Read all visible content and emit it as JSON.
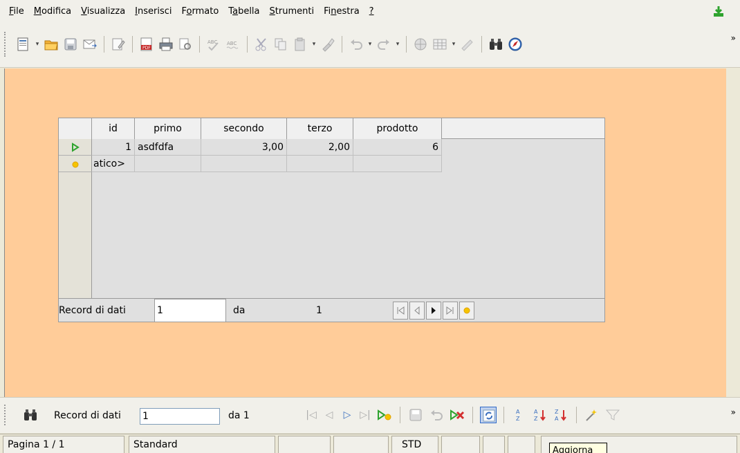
{
  "menu": [
    {
      "label": "File",
      "mnemonic_index": 0
    },
    {
      "label": "Modifica",
      "mnemonic_index": 0
    },
    {
      "label": "Visualizza",
      "mnemonic_index": 0
    },
    {
      "label": "Inserisci",
      "mnemonic_index": 0
    },
    {
      "label": "Formato",
      "mnemonic_index": 1
    },
    {
      "label": "Tabella",
      "mnemonic_index": 1
    },
    {
      "label": "Strumenti",
      "mnemonic_index": 0
    },
    {
      "label": "Finestra",
      "mnemonic_index": 2
    },
    {
      "label": "?",
      "mnemonic_index": 0
    }
  ],
  "grid": {
    "columns": [
      "",
      "id",
      "primo",
      "secondo",
      "terzo",
      "prodotto"
    ],
    "rows": [
      {
        "id": "1",
        "primo": "asdfdfa",
        "secondo": "3,00",
        "terzo": "2,00",
        "prodotto": "6"
      },
      {
        "id": "atico>",
        "primo": "",
        "secondo": "",
        "terzo": "",
        "prodotto": ""
      }
    ],
    "nav": {
      "label": "Record di dati",
      "value": "1",
      "da_label": "da",
      "total": "1"
    }
  },
  "formnav": {
    "label": "Record di dati",
    "value": "1",
    "da_label": "da 1"
  },
  "status": {
    "page": "Pagina 1 / 1",
    "style": "Standard",
    "mode": "STD"
  },
  "tooltip": "Aggiorna",
  "colors": {
    "background": "#ffcc99",
    "grid": "#e0e0e0",
    "active_row": "#2ea32e"
  }
}
